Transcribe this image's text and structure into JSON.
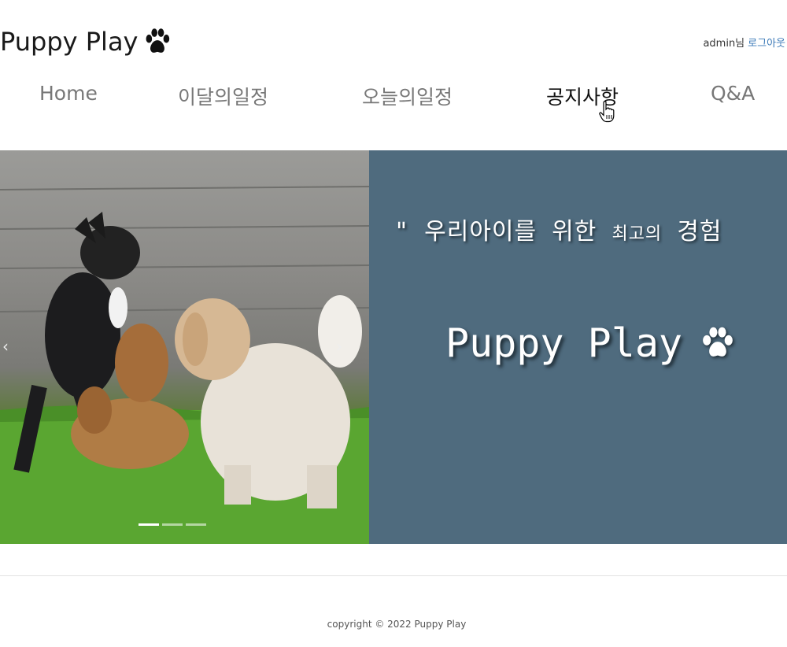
{
  "header": {
    "brand_title": "Puppy Play",
    "brand_icon": "paw-icon",
    "user_name": "admin님",
    "logout_label": "로그아웃"
  },
  "nav": {
    "items": [
      {
        "label": "Home"
      },
      {
        "label": "이달의일정"
      },
      {
        "label": "오늘의일정"
      },
      {
        "label": "공지사항",
        "active": true
      },
      {
        "label": "Q&A"
      }
    ]
  },
  "hero": {
    "carousel": {
      "image": "dogs-playing-on-grass",
      "prev_icon": "chevron-left-icon",
      "next_icon": "chevron-right-icon",
      "slide_count": 3,
      "active_slide": 1
    },
    "promo": {
      "tagline_quote": "\"",
      "tagline_main": "우리아이를 위한",
      "tagline_small": "최고의",
      "tagline_end": "경험",
      "title": "Puppy Play",
      "title_icon": "paw-icon",
      "background_color": "#4f6b7e"
    }
  },
  "footer": {
    "copyright": "copyright © 2022 Puppy Play"
  },
  "colors": {
    "nav_text": "#777777",
    "nav_active": "#111111",
    "link": "#3c7ab8",
    "promo_bg": "#4f6b7e"
  }
}
